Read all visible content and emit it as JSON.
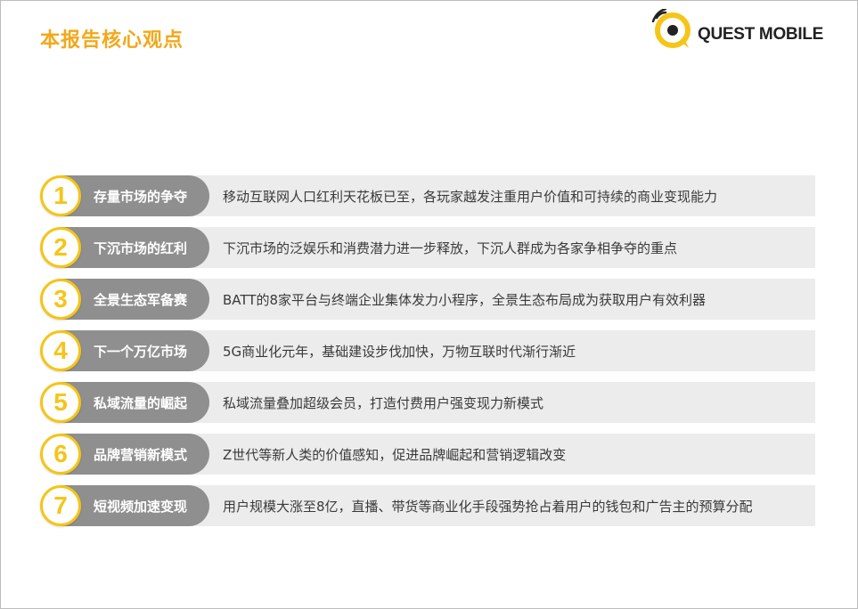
{
  "header": {
    "title": "本报告核心观点",
    "brand_name": "QUEST MOBILE"
  },
  "colors": {
    "accent": "#f2a81a",
    "circle": "#f5c518",
    "pill": "#8f8f8f",
    "bar": "#ececec"
  },
  "points": [
    {
      "num": "1",
      "label": "存量市场的争夺",
      "desc": "移动互联网人口红利天花板已至，各玩家越发注重用户价值和可持续的商业变现能力"
    },
    {
      "num": "2",
      "label": "下沉市场的红利",
      "desc": "下沉市场的泛娱乐和消费潜力进一步释放，下沉人群成为各家争相争夺的重点"
    },
    {
      "num": "3",
      "label": "全景生态军备赛",
      "desc": "BATT的8家平台与终端企业集体发力小程序，全景生态布局成为获取用户有效利器"
    },
    {
      "num": "4",
      "label": "下一个万亿市场",
      "desc": "5G商业化元年，基础建设步伐加快，万物互联时代渐行渐近"
    },
    {
      "num": "5",
      "label": "私域流量的崛起",
      "desc": "私域流量叠加超级会员，打造付费用户强变现力新模式"
    },
    {
      "num": "6",
      "label": "品牌营销新模式",
      "desc": "Z世代等新人类的价值感知，促进品牌崛起和营销逻辑改变"
    },
    {
      "num": "7",
      "label": "短视频加速变现",
      "desc": "用户规模大涨至8亿，直播、带货等商业化手段强势抢占着用户的钱包和广告主的预算分配"
    }
  ]
}
